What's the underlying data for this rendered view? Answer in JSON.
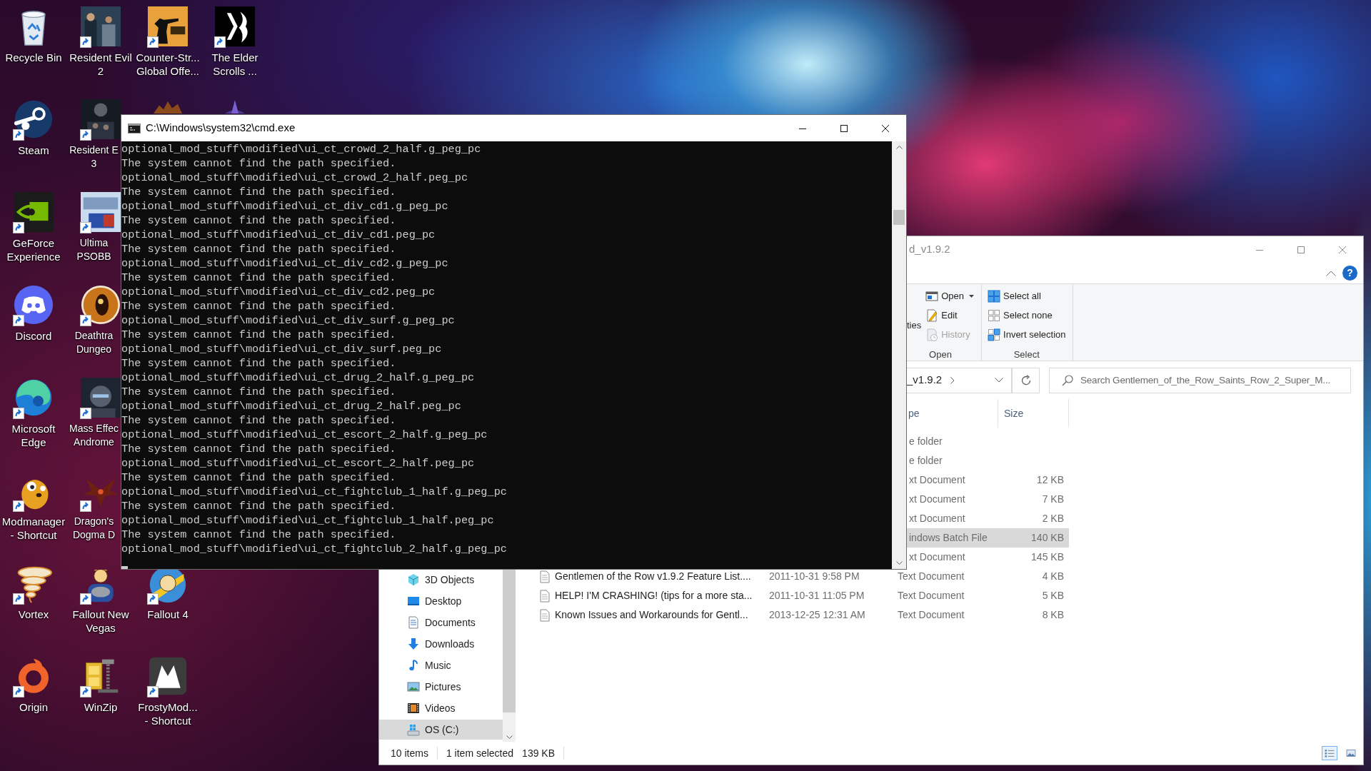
{
  "desktop_icons": [
    {
      "kind": "recyclebin",
      "shortcut": false,
      "label": [
        "Recycle Bin"
      ]
    },
    {
      "kind": "steam",
      "shortcut": true,
      "label": [
        "Steam"
      ]
    },
    {
      "kind": "eyetile",
      "shortcut": true,
      "label": [
        "GeForce",
        "Experience"
      ]
    },
    {
      "kind": "discord",
      "shortcut": true,
      "label": [
        "Discord"
      ]
    },
    {
      "kind": "swirl",
      "shortcut": true,
      "label": [
        "Microsoft",
        "Edge"
      ]
    },
    {
      "kind": "mascot",
      "shortcut": true,
      "label": [
        "Modmanager",
        "- Shortcut"
      ]
    },
    {
      "kind": "tornado",
      "shortcut": true,
      "label": [
        "Vortex"
      ]
    },
    {
      "kind": "ring",
      "shortcut": true,
      "label": [
        "Origin"
      ]
    },
    {
      "kind": "coverteal",
      "shortcut": true,
      "label": [
        "Resident Evil",
        "2"
      ]
    },
    {
      "kind": "coverdark",
      "shortcut": true,
      "label": [
        "Resident E",
        "3"
      ]
    },
    {
      "kind": "coverpale",
      "shortcut": true,
      "label": [
        "Ultima",
        "PSOBB"
      ]
    },
    {
      "kind": "skulldisc",
      "shortcut": true,
      "label": [
        "Deathtra",
        "Dungeo"
      ]
    },
    {
      "kind": "coverhelmet",
      "shortcut": true,
      "label": [
        "Mass Effec",
        "Androme"
      ]
    },
    {
      "kind": "dragon",
      "shortcut": true,
      "label": [
        "Dragon's",
        "Dogma D"
      ]
    },
    {
      "kind": "cartoon",
      "shortcut": true,
      "label": [
        "Fallout New",
        "Vegas"
      ]
    },
    {
      "kind": "cabinet",
      "shortcut": true,
      "label": [
        "WinZip"
      ]
    },
    {
      "kind": "coverorange",
      "shortcut": true,
      "label": [
        "Counter-Str...",
        "Global Offe..."
      ]
    },
    {
      "kind": "peekcreature"
    },
    {
      "kind": "cartoondisc",
      "shortcut": true,
      "label": [
        "Fallout 4"
      ]
    },
    {
      "kind": "logotile",
      "shortcut": true,
      "label": [
        "FrostyMod...",
        "- Shortcut"
      ]
    },
    {
      "kind": "coverblack",
      "shortcut": true,
      "label": [
        "The Elder",
        "Scrolls ..."
      ]
    },
    {
      "kind": "peekcrystal"
    }
  ],
  "cmd_window": {
    "title": "C:\\Windows\\system32\\cmd.exe",
    "active": true,
    "cursor": true,
    "lines": [
      "optional_mod_stuff\\modified\\ui_ct_crowd_2_half.g_peg_pc",
      "The system cannot find the path specified.",
      "optional_mod_stuff\\modified\\ui_ct_crowd_2_half.peg_pc",
      "The system cannot find the path specified.",
      "optional_mod_stuff\\modified\\ui_ct_div_cd1.g_peg_pc",
      "The system cannot find the path specified.",
      "optional_mod_stuff\\modified\\ui_ct_div_cd1.peg_pc",
      "The system cannot find the path specified.",
      "optional_mod_stuff\\modified\\ui_ct_div_cd2.g_peg_pc",
      "The system cannot find the path specified.",
      "optional_mod_stuff\\modified\\ui_ct_div_cd2.peg_pc",
      "The system cannot find the path specified.",
      "optional_mod_stuff\\modified\\ui_ct_div_surf.g_peg_pc",
      "The system cannot find the path specified.",
      "optional_mod_stuff\\modified\\ui_ct_div_surf.peg_pc",
      "The system cannot find the path specified.",
      "optional_mod_stuff\\modified\\ui_ct_drug_2_half.g_peg_pc",
      "The system cannot find the path specified.",
      "optional_mod_stuff\\modified\\ui_ct_drug_2_half.peg_pc",
      "The system cannot find the path specified.",
      "optional_mod_stuff\\modified\\ui_ct_escort_2_half.g_peg_pc",
      "The system cannot find the path specified.",
      "optional_mod_stuff\\modified\\ui_ct_escort_2_half.peg_pc",
      "The system cannot find the path specified.",
      "optional_mod_stuff\\modified\\ui_ct_fightclub_1_half.g_peg_pc",
      "The system cannot find the path specified.",
      "optional_mod_stuff\\modified\\ui_ct_fightclub_1_half.peg_pc",
      "The system cannot find the path specified.",
      "optional_mod_stuff\\modified\\ui_ct_fightclub_2_half.g_peg_pc"
    ]
  },
  "explorer_window": {
    "title": "d_v1.9.2",
    "active": false,
    "help": "?",
    "ribbon": {
      "groups": [
        {
          "label": "Open",
          "commands": [
            {
              "kind": "large",
              "label": "ties",
              "disabled": false,
              "dropdown": false
            },
            {
              "kind": "open",
              "label": "Open",
              "disabled": false,
              "dropdown": true
            },
            {
              "kind": "edit",
              "label": "Edit",
              "disabled": false,
              "dropdown": false
            },
            {
              "kind": "history",
              "label": "History",
              "disabled": true,
              "dropdown": false
            }
          ]
        },
        {
          "label": "Select",
          "commands": [
            {
              "kind": "selectall",
              "label": "Select all",
              "disabled": false,
              "dropdown": false
            },
            {
              "kind": "selectnone",
              "label": "Select none",
              "disabled": false,
              "dropdown": false
            },
            {
              "kind": "invert",
              "label": "Invert selection",
              "disabled": false,
              "dropdown": false
            }
          ]
        }
      ]
    },
    "address": {
      "value": "_v1.9.2"
    },
    "search": {
      "placeholder": "Search Gentlemen_of_the_Row_Saints_Row_2_Super_M..."
    },
    "navigation": [
      {
        "kind": "objects",
        "label": "3D Objects",
        "selected": false
      },
      {
        "kind": "desktop",
        "label": "Desktop",
        "selected": false
      },
      {
        "kind": "documents",
        "label": "Documents",
        "selected": false
      },
      {
        "kind": "downloads",
        "label": "Downloads",
        "selected": false
      },
      {
        "kind": "music",
        "label": "Music",
        "selected": false
      },
      {
        "kind": "pictures",
        "label": "Pictures",
        "selected": false
      },
      {
        "kind": "videos",
        "label": "Videos",
        "selected": false
      },
      {
        "kind": "drive",
        "label": "OS (C:)",
        "selected": true
      }
    ],
    "columns": [
      "pe",
      "Size"
    ],
    "files": [
      {
        "type": "e folder",
        "selected": false
      },
      {
        "type": "e folder",
        "selected": false
      },
      {
        "type": "xt Document",
        "size": "12 KB",
        "selected": false
      },
      {
        "type": "xt Document",
        "size": "7 KB",
        "selected": false
      },
      {
        "type": "xt Document",
        "size": "2 KB",
        "selected": false
      },
      {
        "type": "indows Batch File",
        "size": "140 KB",
        "selected": true
      },
      {
        "type": "xt Document",
        "size": "145 KB",
        "selected": false
      },
      {
        "name": "Gentlemen of the Row v1.9.2 Feature List....",
        "date": "2011-10-31 9:58 PM",
        "type": "Text Document",
        "size": "4 KB",
        "selected": false
      },
      {
        "name": "HELP! I'M CRASHING! (tips for a more sta...",
        "date": "2011-10-31 11:05 PM",
        "type": "Text Document",
        "size": "5 KB",
        "selected": false
      },
      {
        "name": "Known Issues and Workarounds for Gentl...",
        "date": "2013-12-25 12:31 AM",
        "type": "Text Document",
        "size": "8 KB",
        "selected": false
      }
    ],
    "status_bar": {
      "item_count": "10 items",
      "selection": "1 item selected",
      "selection_size": "139 KB"
    },
    "views": [
      {
        "kind": "details",
        "selected": true
      },
      {
        "kind": "tiles",
        "selected": false
      }
    ]
  }
}
